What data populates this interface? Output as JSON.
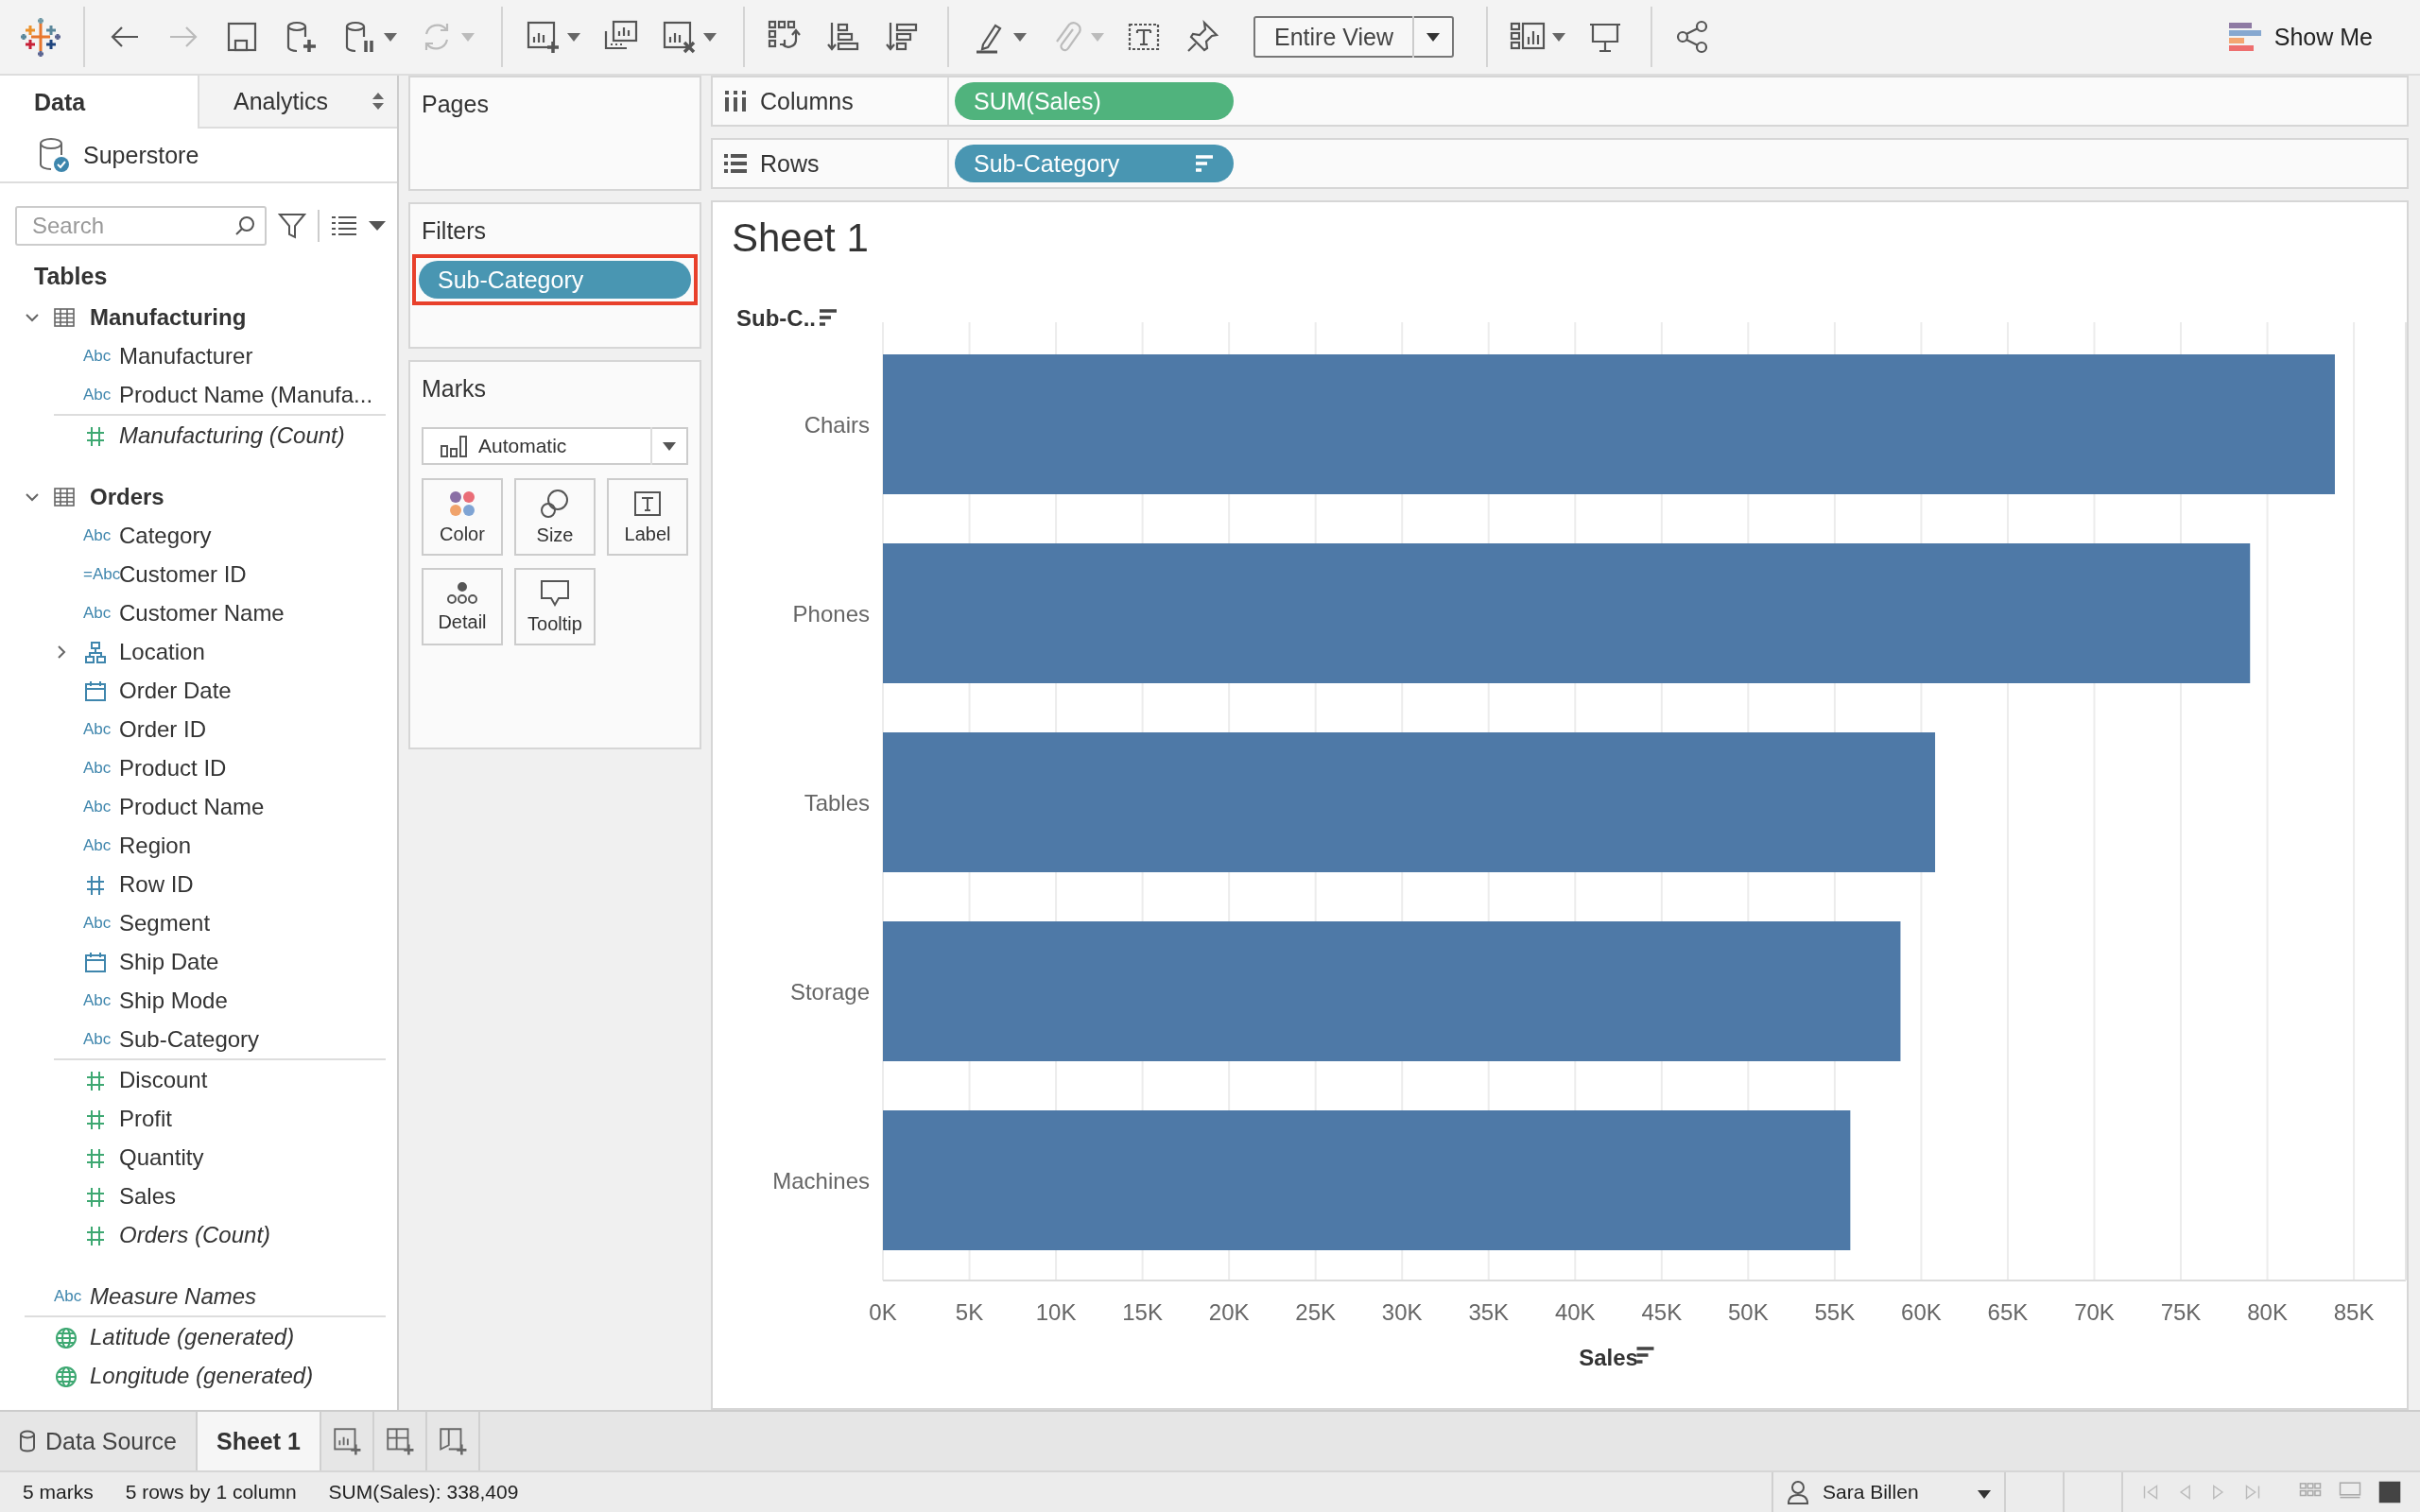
{
  "toolbar": {
    "items": [
      {
        "kind": "separator"
      },
      {
        "kind": "undo",
        "disabled": false,
        "menu": false
      },
      {
        "kind": "redo",
        "disabled": true,
        "menu": false
      },
      {
        "kind": "save",
        "disabled": false,
        "menu": false
      },
      {
        "kind": "new_source",
        "disabled": false,
        "menu": false
      },
      {
        "kind": "pause",
        "disabled": false,
        "menu": true
      },
      {
        "kind": "refresh",
        "disabled": true,
        "menu": true
      },
      {
        "kind": "separator"
      },
      {
        "kind": "new_sheet",
        "disabled": false,
        "menu": true
      },
      {
        "kind": "duplicate",
        "disabled": false,
        "menu": false
      },
      {
        "kind": "clear",
        "disabled": false,
        "menu": true
      },
      {
        "kind": "separator"
      },
      {
        "kind": "swap",
        "disabled": false,
        "menu": false
      },
      {
        "kind": "sort_asc",
        "disabled": false,
        "menu": false
      },
      {
        "kind": "sort_desc",
        "disabled": false,
        "menu": false
      },
      {
        "kind": "separator"
      },
      {
        "kind": "highlight",
        "disabled": false,
        "menu": true
      },
      {
        "kind": "group",
        "disabled": true,
        "menu": true
      },
      {
        "kind": "labels",
        "disabled": false,
        "menu": false
      },
      {
        "kind": "fix",
        "disabled": false,
        "menu": false
      },
      {
        "kind": "fit",
        "label": "Entire View"
      },
      {
        "kind": "separator"
      },
      {
        "kind": "cards",
        "disabled": false,
        "menu": true
      },
      {
        "kind": "present",
        "disabled": false,
        "menu": false
      },
      {
        "kind": "separator"
      },
      {
        "kind": "share",
        "disabled": false,
        "menu": false
      }
    ],
    "show_me": "Show Me"
  },
  "side_tabs": [
    {
      "label": "Data",
      "selected": true
    },
    {
      "label": "Analytics",
      "selected": false
    }
  ],
  "data_source": "Superstore",
  "search": {
    "placeholder": "Search"
  },
  "tables_heading": "Tables",
  "tree": [
    {
      "kind": "table",
      "name": "Manufacturing",
      "expanded": true,
      "children": [
        {
          "kind": "string",
          "name": "Manufacturer",
          "badge": "Abc",
          "measure": false,
          "generated": false
        },
        {
          "kind": "string",
          "name": "Product Name (Manufa...",
          "badge": "Abc",
          "measure": false,
          "generated": false
        },
        {
          "kind": "number",
          "name": "Manufacturing (Count)",
          "measure": true,
          "generated": true
        }
      ]
    },
    {
      "kind": "table",
      "name": "Orders",
      "expanded": true,
      "children": [
        {
          "kind": "string",
          "name": "Category",
          "badge": "Abc",
          "measure": false,
          "generated": false
        },
        {
          "kind": "string",
          "name": "Customer ID",
          "badge": "=Abc",
          "measure": false,
          "generated": false
        },
        {
          "kind": "string",
          "name": "Customer Name",
          "badge": "Abc",
          "measure": false,
          "generated": false
        },
        {
          "kind": "hierarchy",
          "name": "Location",
          "measure": false,
          "generated": false,
          "expanded": false
        },
        {
          "kind": "date",
          "name": "Order Date",
          "measure": false,
          "generated": false
        },
        {
          "kind": "string",
          "name": "Order ID",
          "badge": "Abc",
          "measure": false,
          "generated": false
        },
        {
          "kind": "string",
          "name": "Product ID",
          "badge": "Abc",
          "measure": false,
          "generated": false
        },
        {
          "kind": "string",
          "name": "Product Name",
          "badge": "Abc",
          "measure": false,
          "generated": false
        },
        {
          "kind": "string",
          "name": "Region",
          "badge": "Abc",
          "measure": false,
          "generated": false
        },
        {
          "kind": "number",
          "name": "Row ID",
          "measure": false,
          "generated": false
        },
        {
          "kind": "string",
          "name": "Segment",
          "badge": "Abc",
          "measure": false,
          "generated": false
        },
        {
          "kind": "date",
          "name": "Ship Date",
          "measure": false,
          "generated": false
        },
        {
          "kind": "string",
          "name": "Ship Mode",
          "badge": "Abc",
          "measure": false,
          "generated": false
        },
        {
          "kind": "string",
          "name": "Sub-Category",
          "badge": "Abc",
          "measure": false,
          "generated": false
        },
        {
          "kind": "number",
          "name": "Discount",
          "measure": true,
          "generated": false
        },
        {
          "kind": "number",
          "name": "Profit",
          "measure": true,
          "generated": false
        },
        {
          "kind": "number",
          "name": "Quantity",
          "measure": true,
          "generated": false
        },
        {
          "kind": "number",
          "name": "Sales",
          "measure": true,
          "generated": false
        },
        {
          "kind": "number",
          "name": "Orders (Count)",
          "measure": true,
          "generated": true
        }
      ]
    },
    {
      "kind": "string",
      "name": "Measure Names",
      "badge": "Abc",
      "measure": false,
      "generated": true
    },
    {
      "kind": "geo",
      "name": "Latitude (generated)",
      "measure": true,
      "generated": true
    },
    {
      "kind": "geo",
      "name": "Longitude (generated)",
      "measure": true,
      "generated": true
    }
  ],
  "pages": {
    "title": "Pages"
  },
  "filters": {
    "title": "Filters",
    "pills": [
      {
        "label": "Sub-Category",
        "measure": false,
        "highlighted": true
      }
    ]
  },
  "marks": {
    "title": "Marks",
    "mark_type": "Automatic",
    "buttons": [
      {
        "kind": "color",
        "label": "Color"
      },
      {
        "kind": "size",
        "label": "Size"
      },
      {
        "kind": "label",
        "label": "Label"
      },
      {
        "kind": "detail",
        "label": "Detail"
      },
      {
        "kind": "tooltip",
        "label": "Tooltip"
      }
    ]
  },
  "shelves": [
    {
      "kind": "columns",
      "label": "Columns",
      "pills": [
        {
          "label": "SUM(Sales)",
          "measure": true,
          "sorted": false
        }
      ]
    },
    {
      "kind": "rows",
      "label": "Rows",
      "pills": [
        {
          "label": "Sub-Category",
          "measure": false,
          "sorted": true
        }
      ]
    }
  ],
  "sheet": {
    "title": "Sheet 1",
    "chart_data": {
      "type": "bar",
      "orientation": "horizontal",
      "xlabel": "Sales",
      "ylabel": "Sub-C..",
      "grid": true,
      "categories": [
        "Chairs",
        "Phones",
        "Tables",
        "Storage",
        "Machines"
      ],
      "series": [
        {
          "color": "#4e79a7",
          "values": [
            83900,
            79000,
            60800,
            58800,
            55900
          ]
        }
      ],
      "xlim": [
        0,
        88000
      ],
      "xticks": [
        {
          "value": 0,
          "label": "0K"
        },
        {
          "value": 5000,
          "label": "5K"
        },
        {
          "value": 10000,
          "label": "10K"
        },
        {
          "value": 15000,
          "label": "15K"
        },
        {
          "value": 20000,
          "label": "20K"
        },
        {
          "value": 25000,
          "label": "25K"
        },
        {
          "value": 30000,
          "label": "30K"
        },
        {
          "value": 35000,
          "label": "35K"
        },
        {
          "value": 40000,
          "label": "40K"
        },
        {
          "value": 45000,
          "label": "45K"
        },
        {
          "value": 50000,
          "label": "50K"
        },
        {
          "value": 55000,
          "label": "55K"
        },
        {
          "value": 60000,
          "label": "60K"
        },
        {
          "value": 65000,
          "label": "65K"
        },
        {
          "value": 70000,
          "label": "70K"
        },
        {
          "value": 75000,
          "label": "75K"
        },
        {
          "value": 80000,
          "label": "80K"
        },
        {
          "value": 85000,
          "label": "85K"
        }
      ]
    }
  },
  "sheet_tabs": [
    {
      "kind": "data_source",
      "label": "Data Source",
      "selected": false
    },
    {
      "kind": "sheet",
      "label": "Sheet 1",
      "selected": true
    },
    {
      "kind": "new_worksheet"
    },
    {
      "kind": "new_dashboard"
    },
    {
      "kind": "new_story"
    }
  ],
  "status": {
    "marks": "5 marks",
    "dims": "5 rows by 1 column",
    "sum": "SUM(Sales): 338,409",
    "user": "Sara Billen",
    "nav": [
      {
        "kind": "first",
        "disabled": true
      },
      {
        "kind": "prev",
        "disabled": true
      },
      {
        "kind": "next",
        "disabled": true
      },
      {
        "kind": "last",
        "disabled": true
      }
    ],
    "views": [
      {
        "kind": "grid",
        "selected": false
      },
      {
        "kind": "list",
        "selected": false
      },
      {
        "kind": "single",
        "selected": true
      }
    ]
  }
}
